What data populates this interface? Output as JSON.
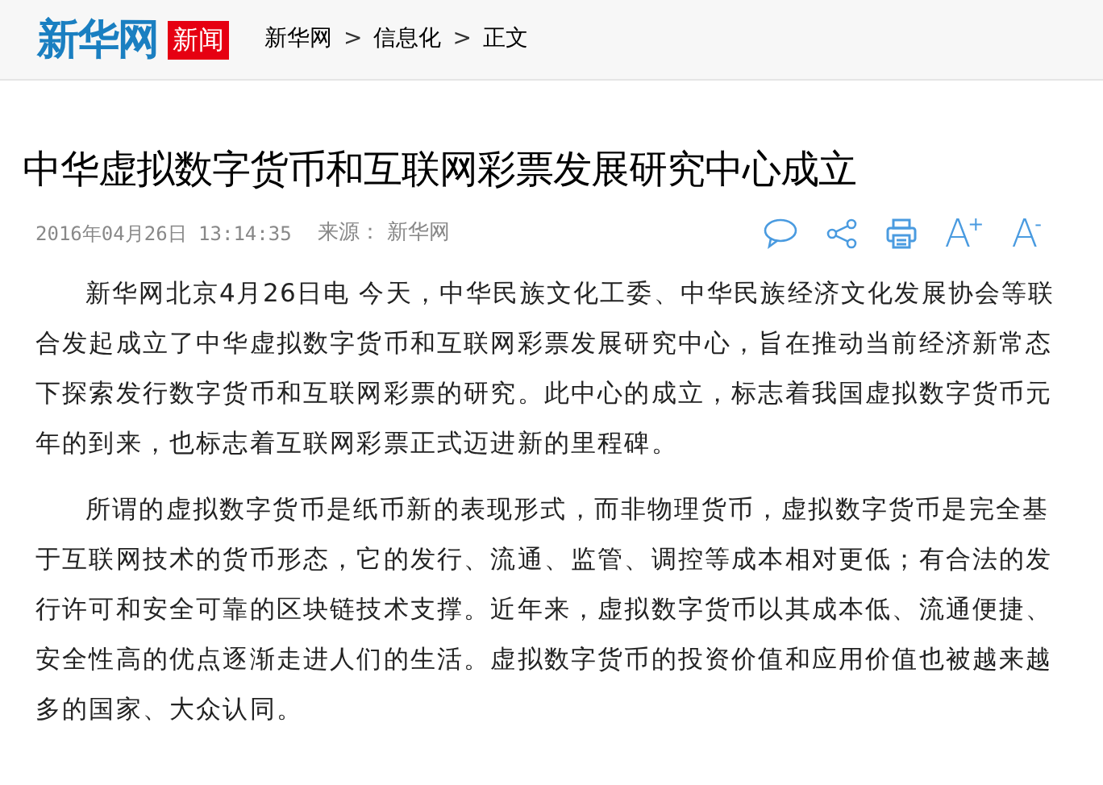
{
  "header": {
    "logo": "新华网",
    "logo_badge": "新闻",
    "breadcrumb": [
      "新华网",
      "信息化",
      "正文"
    ],
    "separator": ">"
  },
  "article": {
    "title": "中华虚拟数字货币和互联网彩票发展研究中心成立",
    "date": "2016年04月26日",
    "time": "13:14:35",
    "source_label": "来源：",
    "source": "新华网",
    "font_buttons": [
      {
        "letter": "A",
        "sign": "+"
      },
      {
        "letter": "A",
        "sign": "-"
      }
    ],
    "paragraphs": [
      "新华网北京4月26日电 今天，中华民族文化工委、中华民族经济文化发展协会等联合发起成立了中华虚拟数字货币和互联网彩票发展研究中心，旨在推动当前经济新常态下探索发行数字货币和互联网彩票的研究。此中心的成立，标志着我国虚拟数字货币元年的到来，也标志着互联网彩票正式迈进新的里程碑。",
      "所谓的虚拟数字货币是纸币新的表现形式，而非物理货币，虚拟数字货币是完全基于互联网技术的货币形态，它的发行、流通、监管、调控等成本相对更低；有合法的发行许可和安全可靠的区块链技术支撑。近年来，虚拟数字货币以其成本低、流通便捷、安全性高的优点逐渐走进人们的生活。虚拟数字货币的投资价值和应用价值也被越来越多的国家、大众认同。"
    ]
  }
}
